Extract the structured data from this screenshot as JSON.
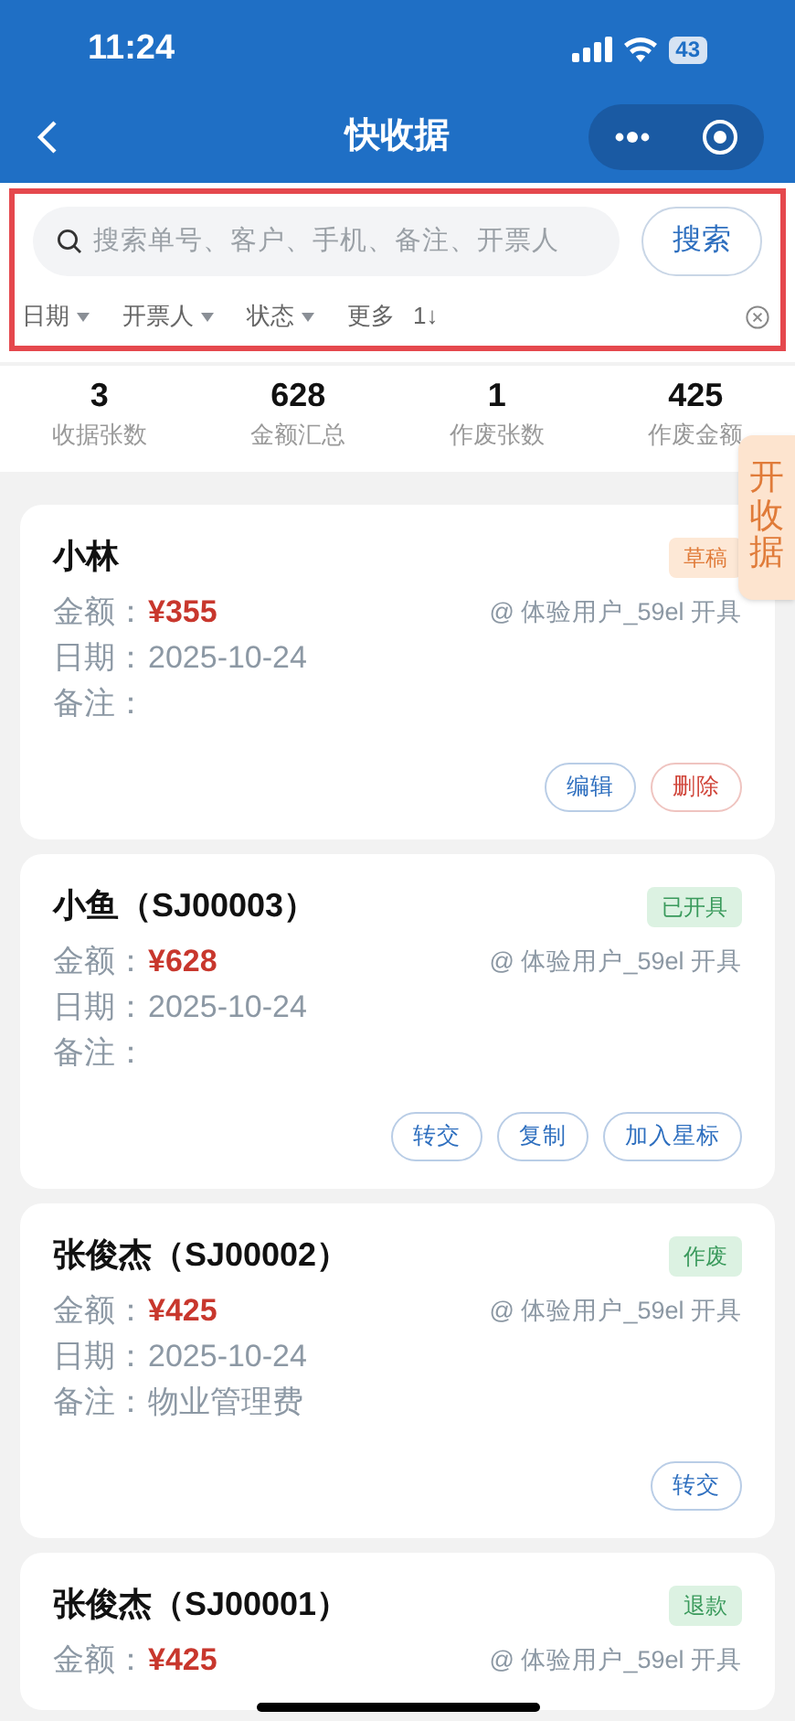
{
  "status_bar": {
    "time": "11:24",
    "battery": "43"
  },
  "nav": {
    "title": "快收据"
  },
  "search": {
    "placeholder": "搜索单号、客户、手机、备注、开票人",
    "button": "搜索"
  },
  "filters": [
    {
      "label": "日期",
      "kind": "dropdown"
    },
    {
      "label": "开票人",
      "kind": "dropdown"
    },
    {
      "label": "状态",
      "kind": "dropdown"
    },
    {
      "label": "更多",
      "kind": "plain"
    },
    {
      "label": "1↓",
      "kind": "sort"
    }
  ],
  "stats": [
    {
      "value": "3",
      "label": "收据张数"
    },
    {
      "value": "628",
      "label": "金额汇总"
    },
    {
      "value": "1",
      "label": "作废张数"
    },
    {
      "value": "425",
      "label": "作废金额"
    }
  ],
  "float_tab": "开收据",
  "receipts": [
    {
      "title": "小林",
      "status": "草稿",
      "kind": "draft",
      "amount_label": "金额：",
      "amount": "¥355",
      "issuer": "@ 体验用户_59el 开具",
      "date_label": "日期：",
      "date": "2025-10-24",
      "note_label": "备注：",
      "actions": [
        {
          "label": "编辑",
          "kind": "primary"
        },
        {
          "label": "删除",
          "kind": "danger"
        }
      ]
    },
    {
      "title": "小鱼（SJ00003）",
      "status": "已开具",
      "kind": "done",
      "amount_label": "金额：",
      "amount": "¥628",
      "issuer": "@ 体验用户_59el 开具",
      "date_label": "日期：",
      "date": "2025-10-24",
      "note_label": "备注：",
      "actions": [
        {
          "label": "转交",
          "kind": "primary"
        },
        {
          "label": "复制",
          "kind": "primary"
        },
        {
          "label": "加入星标",
          "kind": "primary"
        }
      ]
    },
    {
      "title": "张俊杰（SJ00002）",
      "status": "作废",
      "kind": "done",
      "amount_label": "金额：",
      "amount": "¥425",
      "issuer": "@ 体验用户_59el 开具",
      "date_label": "日期：",
      "date": "2025-10-24",
      "note_label": "备注：",
      "note": "物业管理费",
      "actions": [
        {
          "label": "转交",
          "kind": "primary"
        }
      ]
    },
    {
      "title": "张俊杰（SJ00001）",
      "status": "退款",
      "kind": "done",
      "amount_label": "金额：",
      "amount": "¥425",
      "issuer": "@ 体验用户_59el 开具"
    }
  ]
}
